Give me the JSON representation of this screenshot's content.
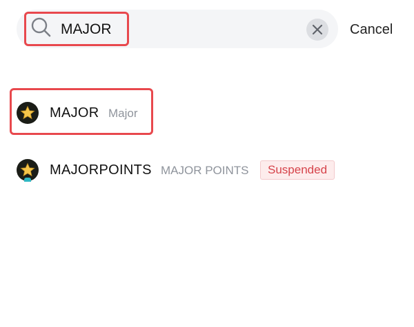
{
  "search": {
    "value": "MAJOR",
    "cancel_label": "Cancel"
  },
  "results": [
    {
      "symbol": "MAJOR",
      "name": "Major",
      "icon": "star-token-icon"
    },
    {
      "symbol": "MAJORPOINTS",
      "name": "MAJOR POINTS",
      "badge": "Suspended",
      "icon": "star-token-icon"
    }
  ],
  "colors": {
    "highlight": "#e8484d",
    "suspended_text": "#d6434a",
    "suspended_bg": "#fdecec",
    "secondary_text": "#8f949c"
  }
}
